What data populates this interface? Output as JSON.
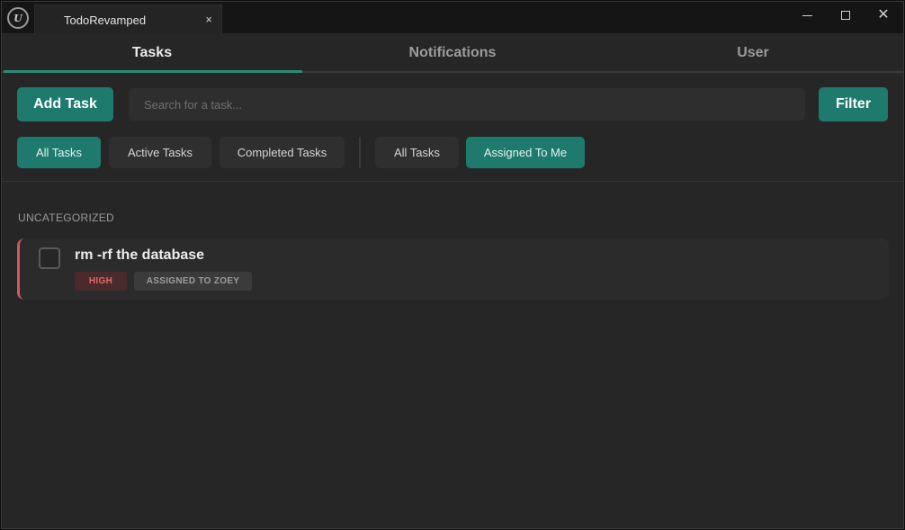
{
  "titlebar": {
    "logo_text": "U",
    "tab_title": "TodoRevamped",
    "tab_close": "×",
    "close_symbol": "✕"
  },
  "main_tabs": [
    {
      "label": "Tasks",
      "active": true
    },
    {
      "label": "Notifications",
      "active": false
    },
    {
      "label": "User",
      "active": false
    }
  ],
  "toolbar": {
    "add_label": "Add Task",
    "search_placeholder": "Search for a task...",
    "filter_label": "Filter"
  },
  "filters": {
    "status": [
      {
        "label": "All Tasks",
        "active": true
      },
      {
        "label": "Active Tasks",
        "active": false
      },
      {
        "label": "Completed Tasks",
        "active": false
      }
    ],
    "assignment": [
      {
        "label": "All Tasks",
        "active": false
      },
      {
        "label": "Assigned To Me",
        "active": true
      }
    ]
  },
  "sections": [
    {
      "heading": "UNCATEGORIZED",
      "tasks": [
        {
          "title": "rm -rf the database",
          "completed": false,
          "priority": "HIGH",
          "assignee": "ASSIGNED TO ZOEY"
        }
      ]
    }
  ],
  "colors": {
    "accent": "#1e7a6c",
    "priority_high": "#e26a6a",
    "background": "#262626"
  }
}
